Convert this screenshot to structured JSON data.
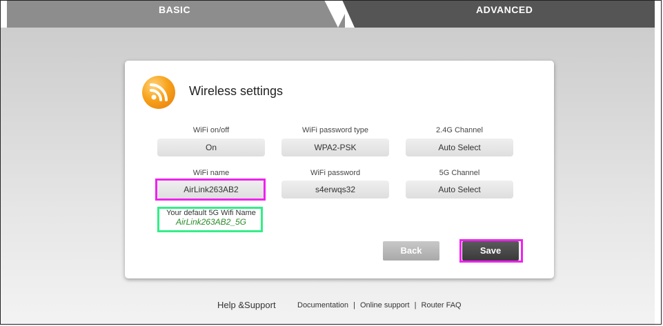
{
  "tabs": {
    "basic": "BASIC",
    "advanced": "ADVANCED"
  },
  "panel": {
    "title": "Wireless settings",
    "fields": {
      "wifi_onoff": {
        "label": "WiFi on/off",
        "value": "On"
      },
      "pw_type": {
        "label": "WiFi password type",
        "value": "WPA2-PSK"
      },
      "ch24": {
        "label": "2.4G Channel",
        "value": "Auto Select"
      },
      "wifi_name": {
        "label": "WiFi name",
        "value": "AirLink263AB2"
      },
      "wifi_pw": {
        "label": "WiFi password",
        "value": "s4erwqs32"
      },
      "ch5": {
        "label": "5G Channel",
        "value": "Auto Select"
      }
    },
    "note": {
      "line1": "Your default 5G Wifi Name",
      "line2": "AirLink263AB2_5G"
    },
    "buttons": {
      "back": "Back",
      "save": "Save"
    }
  },
  "footer": {
    "help": "Help &Support",
    "links": [
      "Documentation",
      "Online support",
      "Router FAQ"
    ],
    "separator": "|"
  },
  "colors": {
    "highlight_pink": "#ee22ee",
    "highlight_green": "#33ee88",
    "icon_orange": "#f7a21b"
  },
  "icons": {
    "title_icon": "wifi-rss-icon"
  }
}
